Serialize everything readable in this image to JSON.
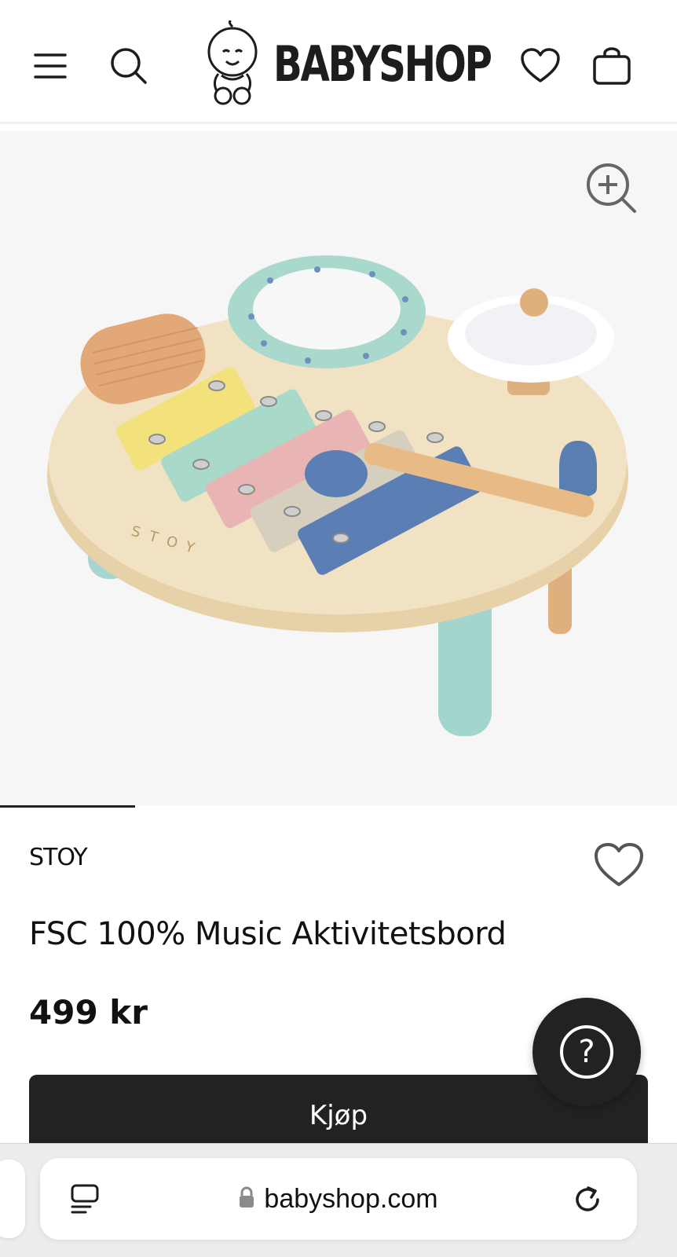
{
  "header": {
    "logo_text": "BABYSHOP",
    "icons": [
      "menu-icon",
      "search-icon",
      "heart-icon",
      "bag-icon"
    ]
  },
  "gallery": {
    "image_alt": "STOY",
    "engraving": "STOY",
    "progress": 0.2,
    "zoom_icon": "zoom-in-icon"
  },
  "product": {
    "brand": "STOY",
    "title": "FSC 100% Music Aktivitetsbord",
    "price": "499 kr"
  },
  "actions": {
    "buy_label": "Kjøp",
    "help_label": "?"
  },
  "browser": {
    "url": "babyshop.com",
    "icons": [
      "reader-icon",
      "lock-icon",
      "reload-icon"
    ]
  },
  "colors": {
    "dark": "#222222",
    "gallery_bg": "#f6f6f6"
  }
}
